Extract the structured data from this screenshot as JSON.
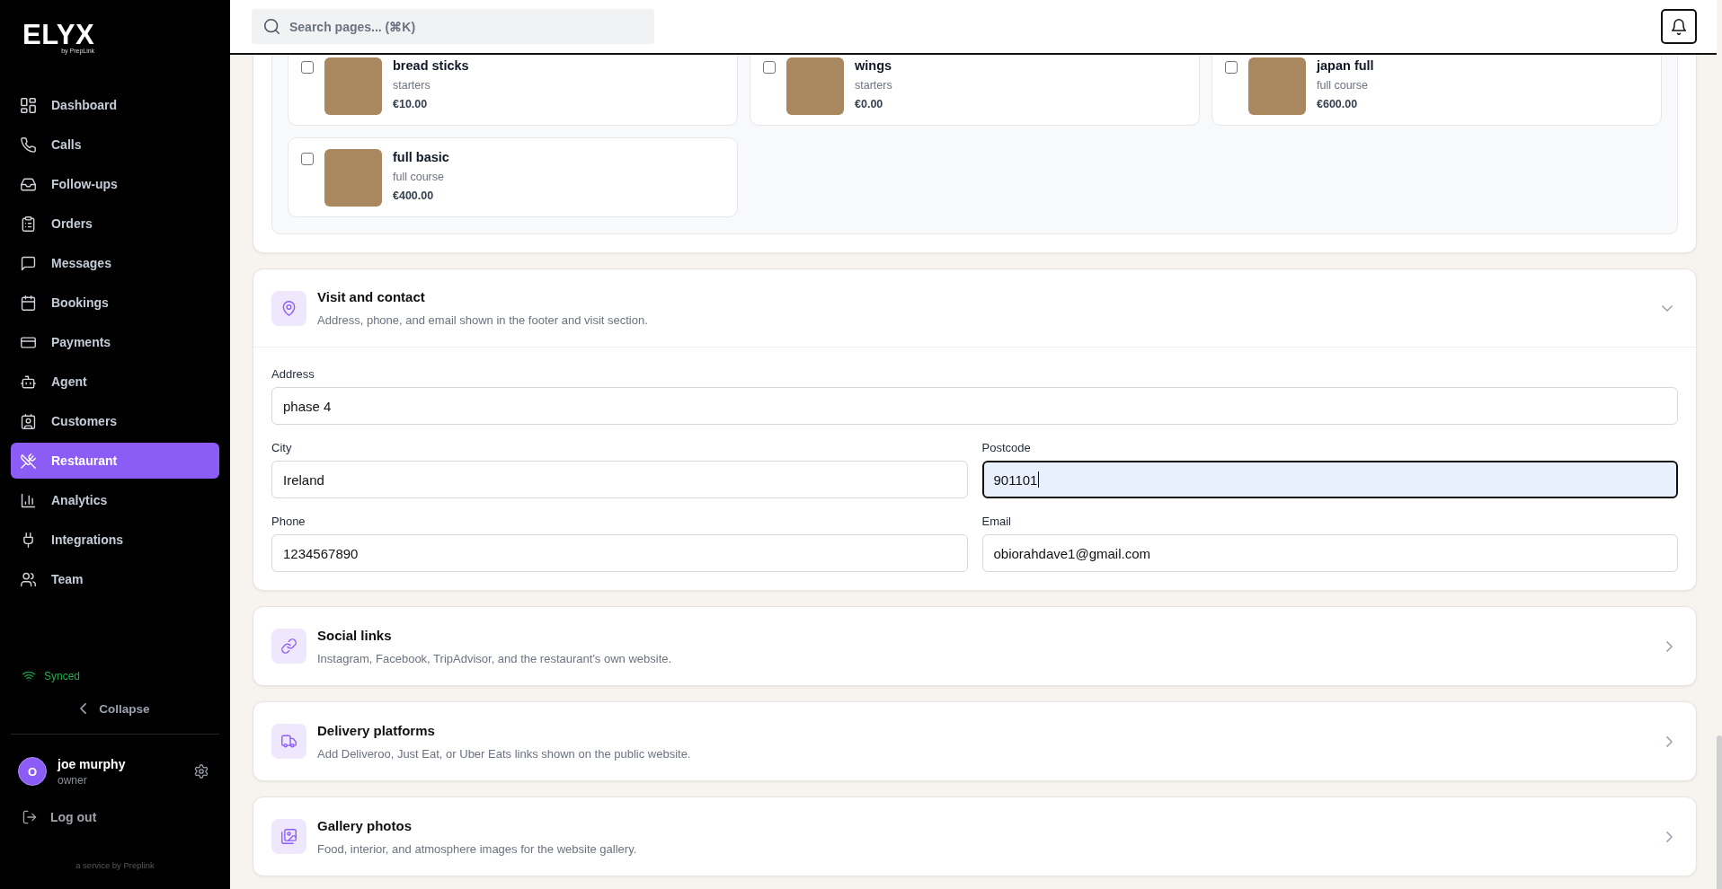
{
  "sidebar": {
    "logo": {
      "wordmark": "ELYX",
      "tagline": "by PrepLink"
    },
    "items": [
      {
        "label": "Dashboard",
        "selected": false
      },
      {
        "label": "Calls",
        "selected": false
      },
      {
        "label": "Follow-ups",
        "selected": false
      },
      {
        "label": "Orders",
        "selected": false
      },
      {
        "label": "Messages",
        "selected": false
      },
      {
        "label": "Bookings",
        "selected": false
      },
      {
        "label": "Payments",
        "selected": false
      },
      {
        "label": "Agent",
        "selected": false
      },
      {
        "label": "Customers",
        "selected": false
      },
      {
        "label": "Restaurant",
        "selected": true
      },
      {
        "label": "Analytics",
        "selected": false
      },
      {
        "label": "Integrations",
        "selected": false
      },
      {
        "label": "Team",
        "selected": false
      }
    ],
    "sync_status": "Synced",
    "collapse": "Collapse",
    "user": {
      "initial": "O",
      "name": "joe murphy",
      "role": "owner"
    },
    "logout": "Log out",
    "credit": "a service by Preplink"
  },
  "top_bar": {
    "search": {
      "placeholder": "Search pages... (⌘K)"
    }
  },
  "menu_items": [
    {
      "name": "bread sticks",
      "category": "starters",
      "price": "€10.00",
      "checked": false
    },
    {
      "name": "wings",
      "category": "starters",
      "price": "€0.00",
      "checked": false
    },
    {
      "name": "japan full",
      "category": "full course",
      "price": "€600.00",
      "checked": false
    },
    {
      "name": "full basic",
      "category": "full course",
      "price": "€400.00",
      "checked": false
    }
  ],
  "sections": [
    {
      "title": "Visit and contact",
      "description": "Address, phone, and email shown in the footer and visit section.",
      "expanded": true,
      "rows": [
        [
          {
            "label": "Address",
            "value": "phase 4",
            "focused": false
          }
        ],
        [
          {
            "label": "City",
            "value": "Ireland",
            "focused": false
          },
          {
            "label": "Postcode",
            "value": "901101",
            "focused": true
          }
        ],
        [
          {
            "label": "Phone",
            "value": "1234567890",
            "focused": false
          },
          {
            "label": "Email",
            "value": "obiorahdave1@gmail.com",
            "focused": false
          }
        ]
      ]
    },
    {
      "title": "Social links",
      "description": "Instagram, Facebook, TripAdvisor, and the restaurant's own website.",
      "expanded": false
    },
    {
      "title": "Delivery platforms",
      "description": "Add Deliveroo, Just Eat, or Uber Eats links shown on the public website.",
      "expanded": false
    },
    {
      "title": "Gallery photos",
      "description": "Food, interior, and atmosphere images for the website gallery.",
      "expanded": false
    }
  ]
}
